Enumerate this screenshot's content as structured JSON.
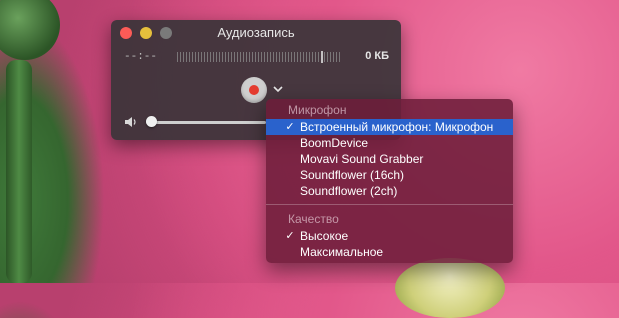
{
  "window": {
    "title": "Аудиозапись",
    "elapsed_time": "--:--",
    "file_size": "0 КБ",
    "volume_level": 0.0
  },
  "menu": {
    "microphone_header": "Микрофон",
    "microphones": [
      {
        "label": "Встроенный микрофон: Микрофон",
        "checked": true,
        "highlighted": true
      },
      {
        "label": "BoomDevice",
        "checked": false,
        "highlighted": false
      },
      {
        "label": "Movavi Sound Grabber",
        "checked": false,
        "highlighted": false
      },
      {
        "label": "Soundflower (16ch)",
        "checked": false,
        "highlighted": false
      },
      {
        "label": "Soundflower (2ch)",
        "checked": false,
        "highlighted": false
      }
    ],
    "quality_header": "Качество",
    "qualities": [
      {
        "label": "Высокое",
        "checked": true
      },
      {
        "label": "Максимальное",
        "checked": false
      }
    ],
    "check_mark": "✓"
  },
  "icons": {
    "record": "record-icon",
    "chevron": "chevron-down-icon",
    "volume": "speaker-icon"
  },
  "colors": {
    "record_red": "#e43b2f",
    "selection_blue": "#2a62cc",
    "close": "#fc5b57",
    "minimize": "#e5bf3c"
  }
}
